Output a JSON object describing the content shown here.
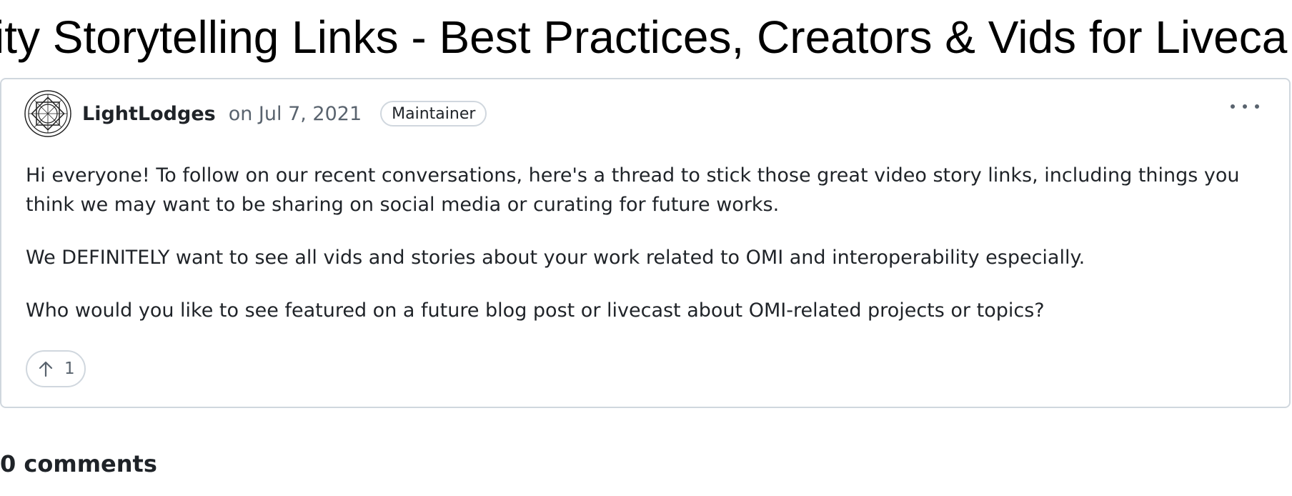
{
  "page": {
    "title": "ity Storytelling Links - Best Practices, Creators & Vids for Liveca"
  },
  "post": {
    "author": "LightLodges",
    "date": "on Jul 7, 2021",
    "badge": "Maintainer",
    "more_icon": "kebab-horizontal-icon",
    "paragraphs": [
      "Hi everyone! To follow on our recent conversations, here's a thread to stick those great video story links, including things you think we may want to be sharing on social media or curating for future works.",
      "We DEFINITELY want to see all vids and stories about your work related to OMI and interoperability especially.",
      "Who would you like to see featured on a future blog post or livecast about OMI-related projects or topics?"
    ],
    "upvote": {
      "icon": "arrow-up-icon",
      "count": "1"
    }
  },
  "comments": {
    "count_label": "0 comments"
  },
  "colors": {
    "border": "#d0d7de",
    "text": "#1f2328",
    "muted": "#59636e"
  }
}
